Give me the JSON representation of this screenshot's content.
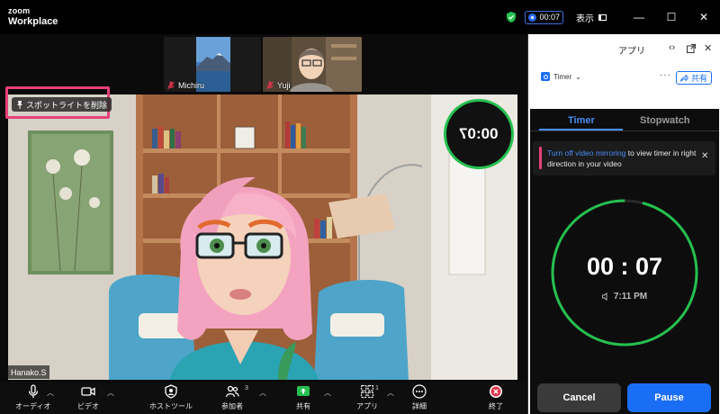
{
  "app": {
    "brand_small": "zoom",
    "brand_large": "Workplace"
  },
  "titlebar": {
    "recording_time": "00:07",
    "view_label": "表示",
    "controls": [
      "—",
      "☐",
      "✕"
    ]
  },
  "thumbnails": [
    {
      "name": "Michiru",
      "muted": true
    },
    {
      "name": "Yuji",
      "muted": true
    }
  ],
  "stage": {
    "spotlight_remove_label": "スポットライトを削除",
    "overlay_timer": "00:07",
    "speaker_name": "Hanako.S"
  },
  "toolbar": {
    "audio": "オーディオ",
    "video": "ビデオ",
    "host_tools": "ホストツール",
    "participants": "参加者",
    "participants_count": "3",
    "share": "共有",
    "apps": "アプリ",
    "apps_count": "1",
    "more": "詳細",
    "end": "終了"
  },
  "panel": {
    "title": "アプリ",
    "app_name": "Timer",
    "share_label": "共有",
    "tabs": {
      "active": "Timer",
      "inactive": "Stopwatch"
    },
    "notice": {
      "link": "Turn off video mirroring",
      "text": " to view timer in right direction in your video"
    },
    "timer": {
      "display": "00 : 07",
      "end_time": "7:11 PM",
      "progress": 0.96
    },
    "cancel_label": "Cancel",
    "pause_label": "Pause"
  },
  "colors": {
    "accent_blue": "#1a6ef5",
    "timer_green": "#25c04f",
    "highlight_pink": "#e8417a"
  }
}
